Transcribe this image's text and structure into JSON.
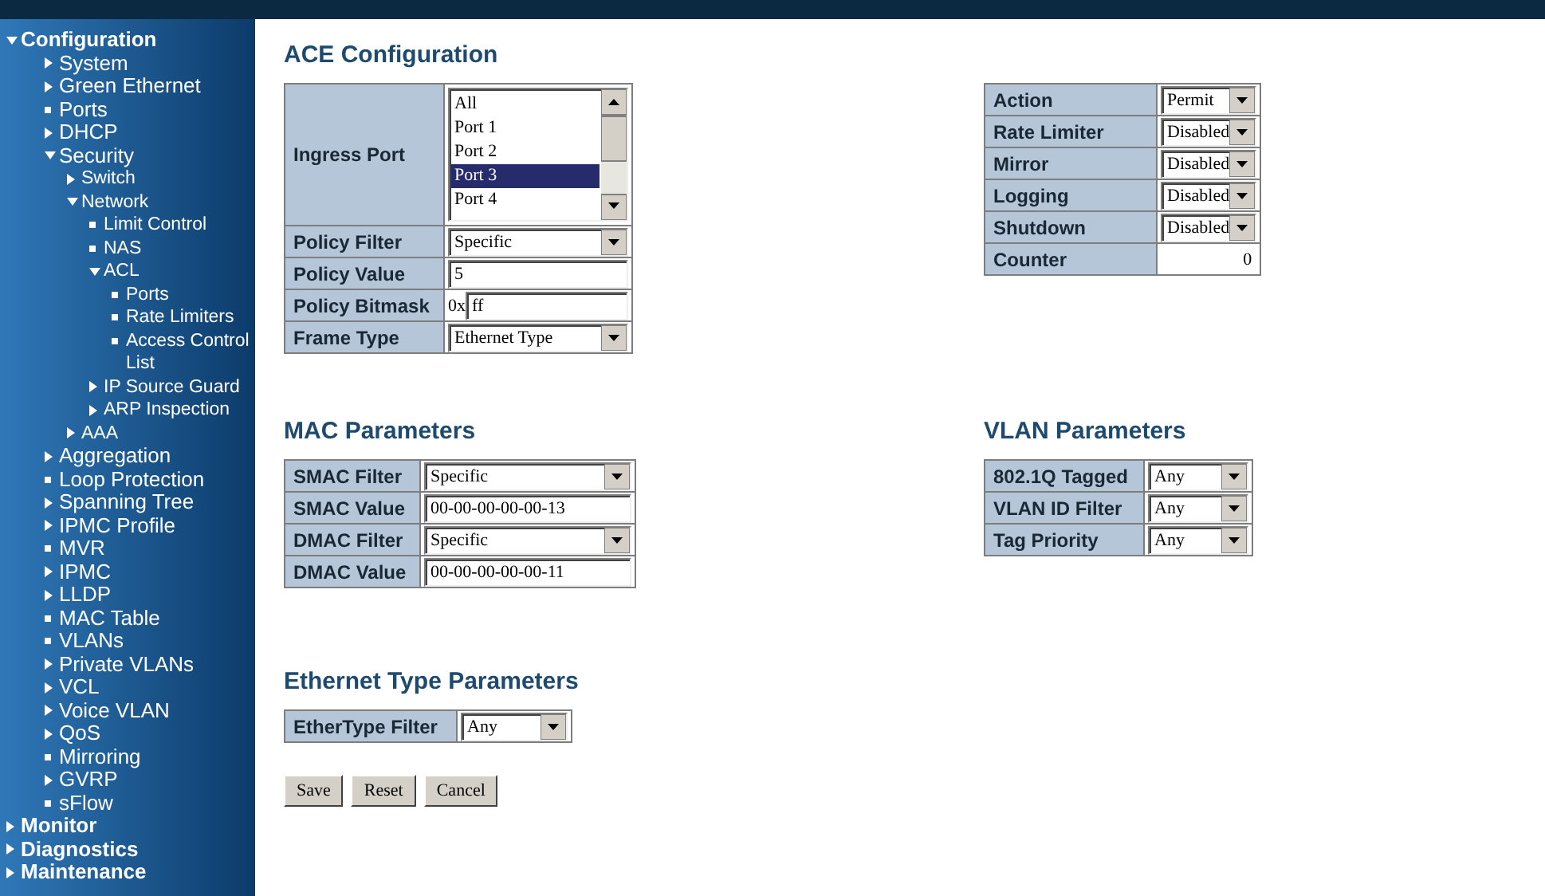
{
  "sidebar": {
    "items": [
      {
        "label": "Configuration",
        "kind": "folder",
        "expanded": true,
        "children": [
          {
            "label": "System",
            "kind": "folder",
            "expanded": false
          },
          {
            "label": "Green Ethernet",
            "kind": "folder",
            "expanded": false
          },
          {
            "label": "Ports",
            "kind": "page"
          },
          {
            "label": "DHCP",
            "kind": "folder",
            "expanded": false
          },
          {
            "label": "Security",
            "kind": "folder",
            "expanded": true,
            "children": [
              {
                "label": "Switch",
                "kind": "folder",
                "expanded": false
              },
              {
                "label": "Network",
                "kind": "folder",
                "expanded": true,
                "children": [
                  {
                    "label": "Limit Control",
                    "kind": "page"
                  },
                  {
                    "label": "NAS",
                    "kind": "page"
                  },
                  {
                    "label": "ACL",
                    "kind": "folder",
                    "expanded": true,
                    "children": [
                      {
                        "label": "Ports",
                        "kind": "page"
                      },
                      {
                        "label": "Rate Limiters",
                        "kind": "page"
                      },
                      {
                        "label": "Access Control List",
                        "kind": "page"
                      }
                    ]
                  },
                  {
                    "label": "IP Source Guard",
                    "kind": "folder",
                    "expanded": false
                  },
                  {
                    "label": "ARP Inspection",
                    "kind": "folder",
                    "expanded": false
                  }
                ]
              },
              {
                "label": "AAA",
                "kind": "folder",
                "expanded": false
              }
            ]
          },
          {
            "label": "Aggregation",
            "kind": "folder",
            "expanded": false
          },
          {
            "label": "Loop Protection",
            "kind": "page"
          },
          {
            "label": "Spanning Tree",
            "kind": "folder",
            "expanded": false
          },
          {
            "label": "IPMC Profile",
            "kind": "folder",
            "expanded": false
          },
          {
            "label": "MVR",
            "kind": "page"
          },
          {
            "label": "IPMC",
            "kind": "folder",
            "expanded": false
          },
          {
            "label": "LLDP",
            "kind": "folder",
            "expanded": false
          },
          {
            "label": "MAC Table",
            "kind": "page"
          },
          {
            "label": "VLANs",
            "kind": "page"
          },
          {
            "label": "Private VLANs",
            "kind": "folder",
            "expanded": false
          },
          {
            "label": "VCL",
            "kind": "folder",
            "expanded": false
          },
          {
            "label": "Voice VLAN",
            "kind": "folder",
            "expanded": false
          },
          {
            "label": "QoS",
            "kind": "folder",
            "expanded": false
          },
          {
            "label": "Mirroring",
            "kind": "page"
          },
          {
            "label": "GVRP",
            "kind": "folder",
            "expanded": false
          },
          {
            "label": "sFlow",
            "kind": "page"
          }
        ]
      },
      {
        "label": "Monitor",
        "kind": "folder",
        "expanded": false
      },
      {
        "label": "Diagnostics",
        "kind": "folder",
        "expanded": false
      },
      {
        "label": "Maintenance",
        "kind": "folder",
        "expanded": false
      }
    ]
  },
  "blocks": [
    {
      "columns": [
        {
          "title": "ACE Configuration",
          "rows": [
            {
              "label": "Ingress Port",
              "kind": "listbox",
              "options": [
                {
                  "label": "All",
                  "selected": false
                },
                {
                  "label": "Port 1",
                  "selected": false
                },
                {
                  "label": "Port 2",
                  "selected": false
                },
                {
                  "label": "Port 3",
                  "selected": true
                },
                {
                  "label": "Port 4",
                  "selected": false
                }
              ]
            },
            {
              "label": "Policy Filter",
              "kind": "select",
              "value": "Specific"
            },
            {
              "label": "Policy Value",
              "kind": "text",
              "value": "5"
            },
            {
              "label": "Policy Bitmask",
              "kind": "bitmask",
              "prefix": "0x",
              "value": "ff"
            },
            {
              "label": "Frame Type",
              "kind": "select",
              "value": "Ethernet Type"
            }
          ]
        },
        {
          "rows": [
            {
              "label": "Action",
              "kind": "select",
              "value": "Permit"
            },
            {
              "label": "Rate Limiter",
              "kind": "select",
              "value": "Disabled"
            },
            {
              "label": "Mirror",
              "kind": "select",
              "value": "Disabled"
            },
            {
              "label": "Logging",
              "kind": "select",
              "value": "Disabled"
            },
            {
              "label": "Shutdown",
              "kind": "select",
              "value": "Disabled"
            },
            {
              "label": "Counter",
              "kind": "number",
              "value": "0"
            }
          ]
        }
      ]
    },
    {
      "columns": [
        {
          "title": "MAC Parameters",
          "rows": [
            {
              "label": "SMAC Filter",
              "kind": "select",
              "value": "Specific"
            },
            {
              "label": "SMAC Value",
              "kind": "text",
              "value": "00-00-00-00-00-13"
            },
            {
              "label": "DMAC Filter",
              "kind": "select",
              "value": "Specific"
            },
            {
              "label": "DMAC Value",
              "kind": "text",
              "value": "00-00-00-00-00-11"
            }
          ]
        },
        {
          "title": "VLAN Parameters",
          "rows": [
            {
              "label": "802.1Q Tagged",
              "kind": "select",
              "value": "Any"
            },
            {
              "label": "VLAN ID Filter",
              "kind": "select",
              "value": "Any"
            },
            {
              "label": "Tag Priority",
              "kind": "select",
              "value": "Any"
            }
          ]
        }
      ]
    },
    {
      "columns": [
        {
          "title": "Ethernet Type Parameters",
          "rows": [
            {
              "label": "EtherType Filter",
              "kind": "select",
              "value": "Any"
            }
          ]
        }
      ]
    }
  ],
  "buttons": [
    "Save",
    "Reset",
    "Cancel"
  ]
}
